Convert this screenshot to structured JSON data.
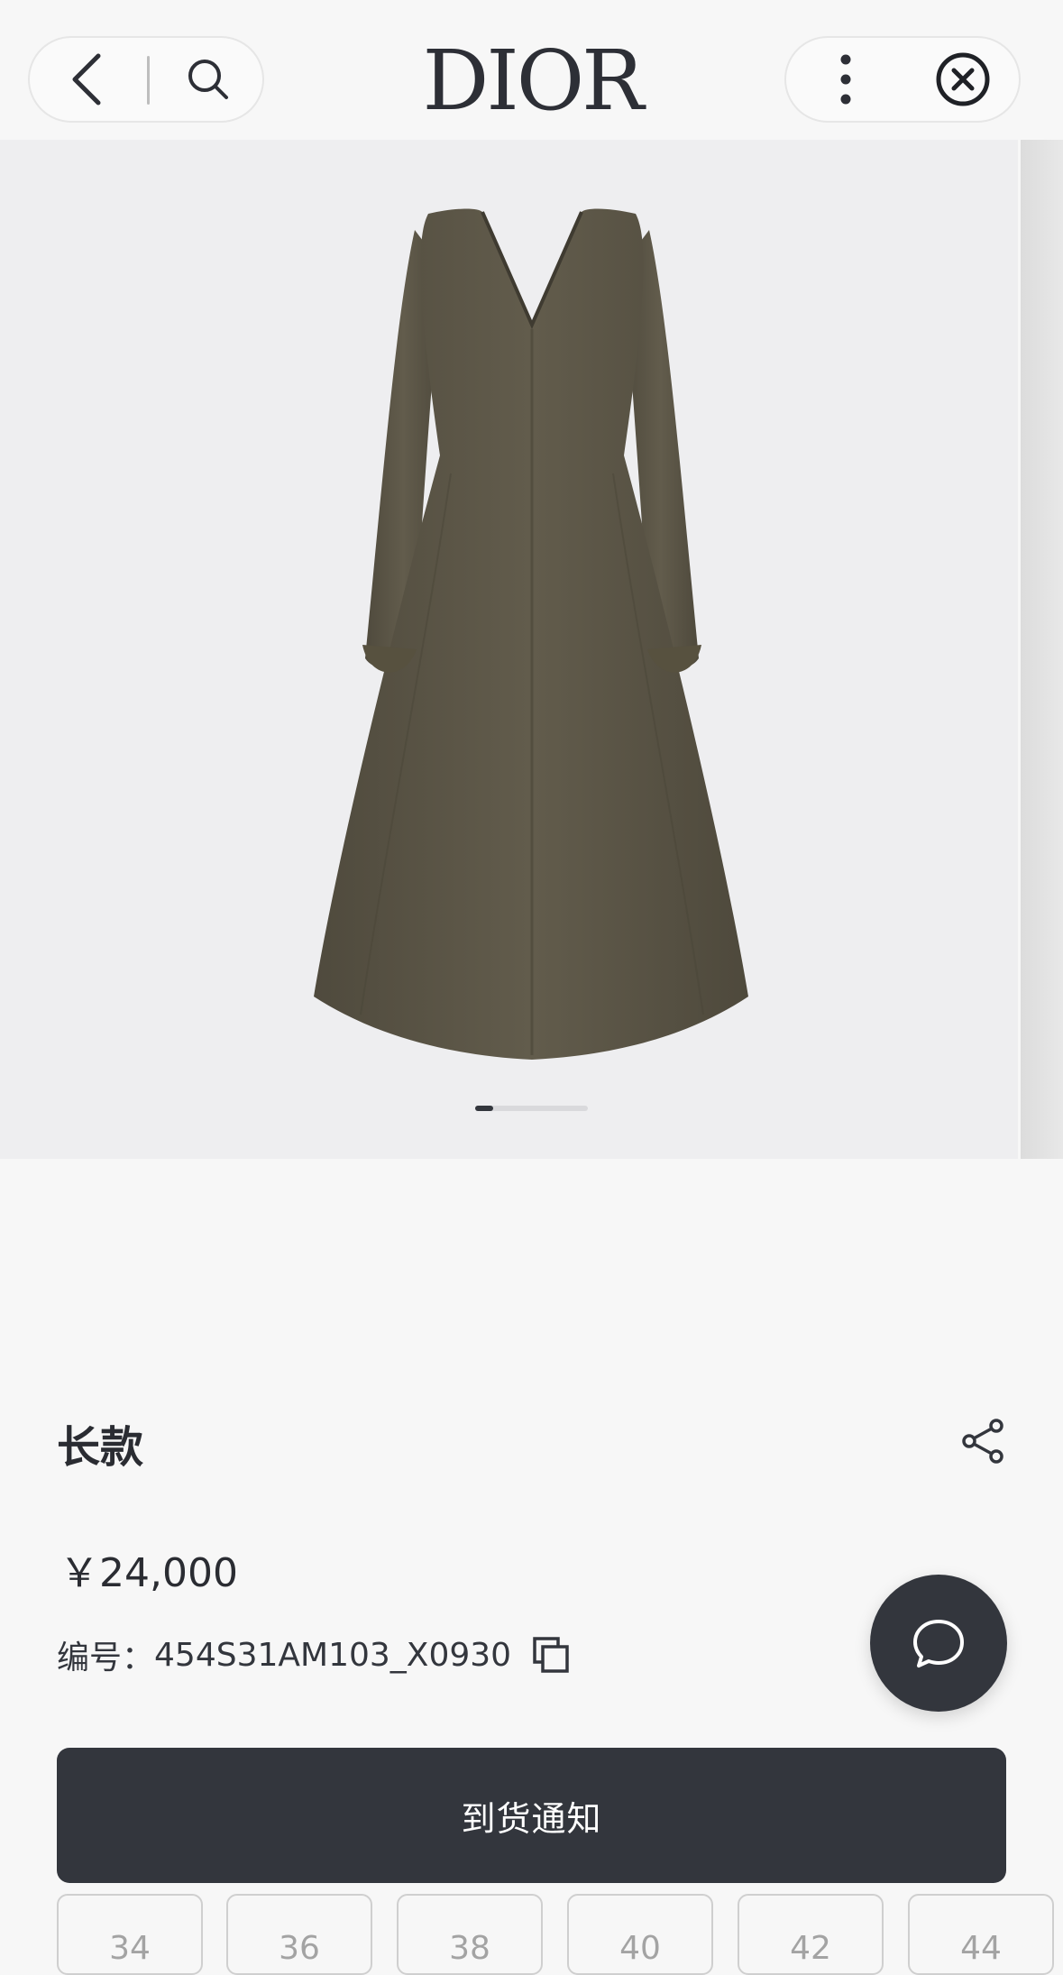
{
  "header": {
    "brand": "DIOR",
    "back_icon": "chevron-left-icon",
    "search_icon": "search-icon",
    "more_icon": "more-vertical-icon",
    "close_icon": "close-circle-icon"
  },
  "gallery": {
    "image_icon": "product-dress-image",
    "page_indicator": {
      "current": 1
    }
  },
  "product": {
    "title": "长款",
    "price": "￥24,000",
    "sku_label": "编号：",
    "sku": "454S31AM103_X0930",
    "share_icon": "share-icon",
    "copy_icon": "copy-icon"
  },
  "actions": {
    "notify_label": "到货通知",
    "chat_icon": "chat-bubble-icon"
  },
  "sizes": [
    "34",
    "36",
    "38",
    "40",
    "42",
    "44"
  ],
  "colors": {
    "accent": "#33363d",
    "background": "#f7f7f7",
    "gallery_bg": "#eeeef0",
    "dress": "#5b5546"
  }
}
